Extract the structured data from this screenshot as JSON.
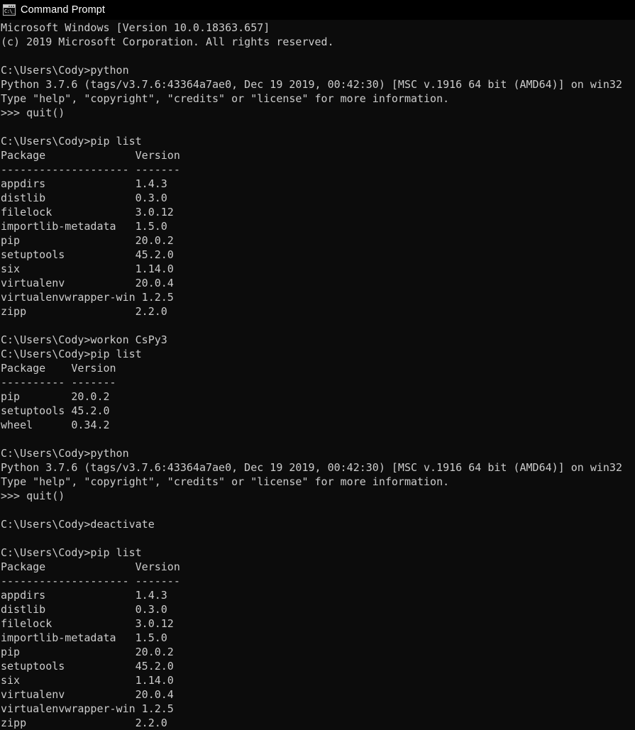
{
  "window": {
    "title": "Command Prompt",
    "icon": "command-prompt-icon",
    "icon_glyph": "C:\\_",
    "titlebar_bg": "#000000",
    "console_bg": "#0c0c0c",
    "console_fg": "#cccccc"
  },
  "console": {
    "lines": [
      "Microsoft Windows [Version 10.0.18363.657]",
      "(c) 2019 Microsoft Corporation. All rights reserved.",
      "",
      "C:\\Users\\Cody>python",
      "Python 3.7.6 (tags/v3.7.6:43364a7ae0, Dec 19 2019, 00:42:30) [MSC v.1916 64 bit (AMD64)] on win32",
      "Type \"help\", \"copyright\", \"credits\" or \"license\" for more information.",
      ">>> quit()",
      "",
      "C:\\Users\\Cody>pip list",
      "Package              Version",
      "-------------------- -------",
      "appdirs              1.4.3",
      "distlib              0.3.0",
      "filelock             3.0.12",
      "importlib-metadata   1.5.0",
      "pip                  20.0.2",
      "setuptools           45.2.0",
      "six                  1.14.0",
      "virtualenv           20.0.4",
      "virtualenvwrapper-win 1.2.5",
      "zipp                 2.2.0",
      "",
      "C:\\Users\\Cody>workon CsPy3",
      "C:\\Users\\Cody>pip list",
      "Package    Version",
      "---------- -------",
      "pip        20.0.2",
      "setuptools 45.2.0",
      "wheel      0.34.2",
      "",
      "C:\\Users\\Cody>python",
      "Python 3.7.6 (tags/v3.7.6:43364a7ae0, Dec 19 2019, 00:42:30) [MSC v.1916 64 bit (AMD64)] on win32",
      "Type \"help\", \"copyright\", \"credits\" or \"license\" for more information.",
      ">>> quit()",
      "",
      "C:\\Users\\Cody>deactivate",
      "",
      "C:\\Users\\Cody>pip list",
      "Package              Version",
      "-------------------- -------",
      "appdirs              1.4.3",
      "distlib              0.3.0",
      "filelock             3.0.12",
      "importlib-metadata   1.5.0",
      "pip                  20.0.2",
      "setuptools           45.2.0",
      "six                  1.14.0",
      "virtualenv           20.0.4",
      "virtualenvwrapper-win 1.2.5",
      "zipp                 2.2.0"
    ]
  }
}
